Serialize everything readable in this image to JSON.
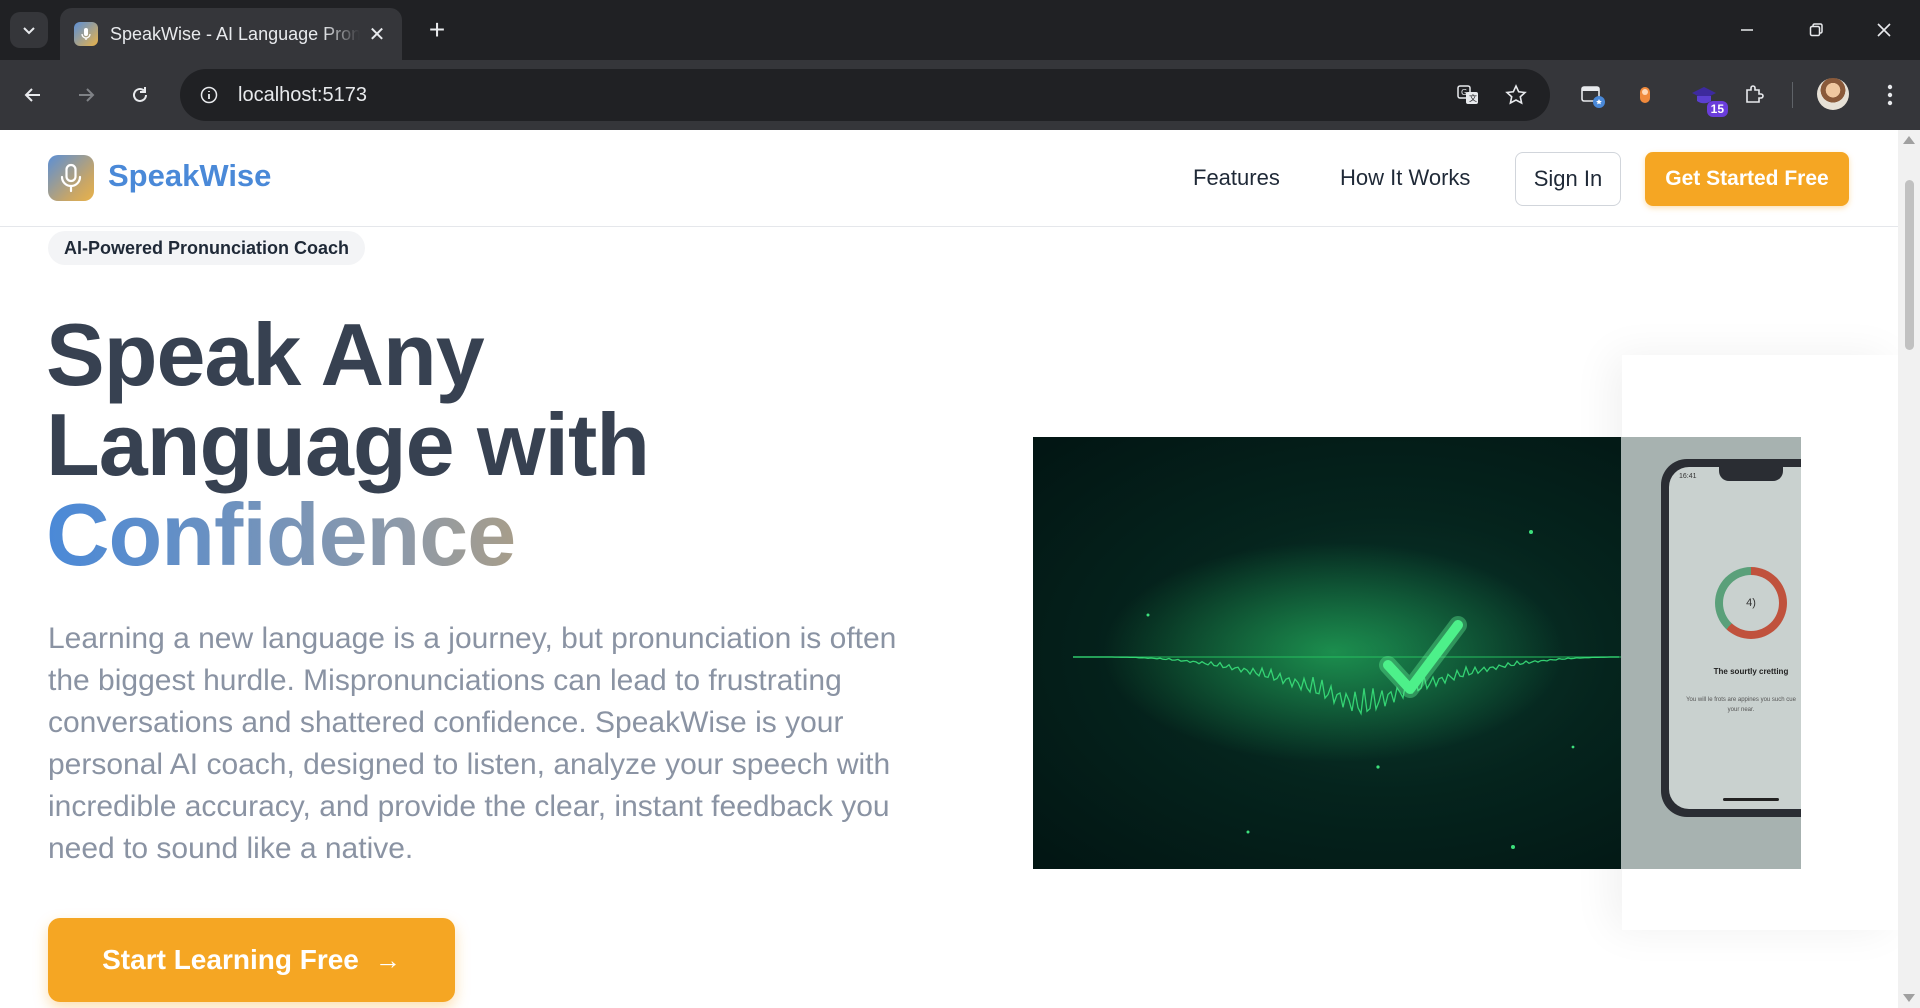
{
  "browser": {
    "tab_title": "SpeakWise - AI Language Pronunciation Coach",
    "url": "localhost:5173",
    "extension_badge": "15",
    "colors": {
      "tabstrip": "#202124",
      "toolbar": "#35363a"
    }
  },
  "navbar": {
    "brand": "SpeakWise",
    "links": [
      "Features",
      "How It Works"
    ],
    "sign_in": "Sign In",
    "get_started": "Get Started Free"
  },
  "hero": {
    "pill": "AI-Powered Pronunciation Coach",
    "headline_line1": "Speak Any",
    "headline_line2": "Language with",
    "headline_highlight": "Confidence",
    "description": "Learning a new language is a journey, but pronunciation is often the biggest hurdle. Mispronunciations can lead to frustrating conversations and shattered confidence. SpeakWise is your personal AI coach, designed to listen, analyze your speech with incredible accuracy, and provide the clear, instant feedback you need to sound like a native.",
    "cta": "Start Learning Free",
    "cta_arrow": "→"
  },
  "phone_mock": {
    "time": "16:41",
    "ring_label": "4)",
    "caption": "The sourtly cretting",
    "sub": "You will le frots are appines you such cue your near."
  },
  "colors": {
    "accent": "#f5a623",
    "brand_blue": "#4a89d8",
    "heading": "#374151",
    "body_text": "#8a93a3"
  }
}
